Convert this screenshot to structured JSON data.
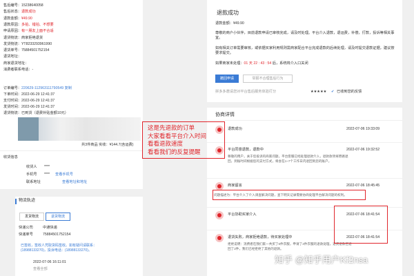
{
  "order": {
    "fields": [
      {
        "label": "售后编号：",
        "value": "15238640058",
        "cls": ""
      },
      {
        "label": "售后状态：",
        "value": "退款成功",
        "cls": "red"
      },
      {
        "label": "退款金额：",
        "value": "¥49.90",
        "cls": "red"
      },
      {
        "label": "退款原因：",
        "value": "多拍、错拍、不想要",
        "cls": "red"
      },
      {
        "label": "申请原因：",
        "value": "有一朋友上面不合适",
        "cls": "red"
      },
      {
        "label": "退货物流：",
        "value": "商家拒绝退货",
        "cls": ""
      },
      {
        "label": "发货物流：",
        "value": "YT8233293961990",
        "cls": ""
      },
      {
        "label": "退货单号：",
        "value": "75884501752154",
        "cls": ""
      },
      {
        "label": "退货地址：",
        "value": "",
        "cls": ""
      },
      {
        "label": "商家退货地址：",
        "value": "",
        "cls": ""
      },
      {
        "label": "消费者联系电话：",
        "value": "-",
        "cls": ""
      }
    ],
    "order_no_label": "订单编号：",
    "order_no": "220629-112963111790549",
    "copy": "复制",
    "order_time": "下单时间：2022-06-29 12:41:37",
    "pay_time": "支付时间：2022-06-29 12:41:37",
    "ship_time": "发货时间：2022-06-29 12:41:37",
    "status": "退货物流：已到货（退费补贴金额10元）",
    "product_summary": "共3件商品  实收：¥144.7(含运费)",
    "receive_title": "收货信息",
    "receiver_label": "收货人",
    "receiver_value": "****",
    "phone_label": "手机号",
    "phone_value": "****",
    "phone_link": "查看手机号",
    "address_label": "联系地址",
    "address_link": "查看地址和地址"
  },
  "logistics": {
    "title": "物流轨迹",
    "tabs": [
      "发货物流",
      "退货物流"
    ],
    "company_label": "快递公司",
    "company": "中通快递",
    "tracking_label": "快递单号",
    "tracking": "75884501752154",
    "event_text": "已签收，签收人凭取货码签收。如有疑问请联系：(18988133270)，投诉电话：(18988133270)。",
    "event_time": "2022-07-06 16:11:01",
    "view_all": "查看全部"
  },
  "refund": {
    "title": "退款成功",
    "amount_label": "退款金额：",
    "amount": "¥49.90",
    "desc1": "尊敬的商户小伙伴，目前退款申请已审核完成，请及时处理。平台介入退款，退运费，补偿，打款，投诉等相关事宜。",
    "desc2": "如有相关订单需要审核，或依据买家利用规则需商家配合平台完成退款的后续处理，请及时提交退款证据，建议按要求提交。",
    "countdown_label": "如果商家未处理：",
    "countdown": "01 天 22 : 43 : 54",
    "countdown_suffix": "后，系统将介入口关闭",
    "primary_btn": "撤回申请",
    "secondary_btn": "举报不合理售后行为",
    "notice_prefix": "拼多多邀请您对平台售后服务体验打分",
    "notice_suffix": "已收到您的反馈"
  },
  "negotiation": {
    "title": "协商详情",
    "items": [
      {
        "title": "退款成功",
        "time": "2022-07-06 19:33:09",
        "text": ""
      },
      {
        "title": "平台同意退款，退款中",
        "time": "2022-07-06 19:32:52",
        "text": "尊敬的用户，关于您投诉的商家问题，平台客服已经处理退款介入，退款款项将原路退回，到账时间根据您的支付方式，将会在1~7个工作日内退回到您的账户。"
      },
      {
        "title": "商家留言",
        "time": "2022-07-06 18:45:45",
        "text": "问题描述为：平台介入了介入调查解决问题，查下明天记录需要协商处理平台解决问题的权利。"
      },
      {
        "title": "平台协助买家介入",
        "time": "2022-07-06 18:41:54",
        "text": ""
      },
      {
        "title": "退货失败，商家拒绝退款，待买家处理中",
        "time": "2022-07-06 18:41:54",
        "text": "拒绝说明：消费者在我们家一共买了6件衣服，申请了4件衣服的退款处理，退货退款已退回了2件，我们已经拒绝了其他的退款。"
      }
    ]
  },
  "overlay": {
    "lines": [
      "这是先退款的订单",
      "大家看看平台介入时间",
      "看看退款速度",
      "看看我们的反复提醒"
    ]
  },
  "watermark": "知乎 @知乎用户Kf2nsa"
}
